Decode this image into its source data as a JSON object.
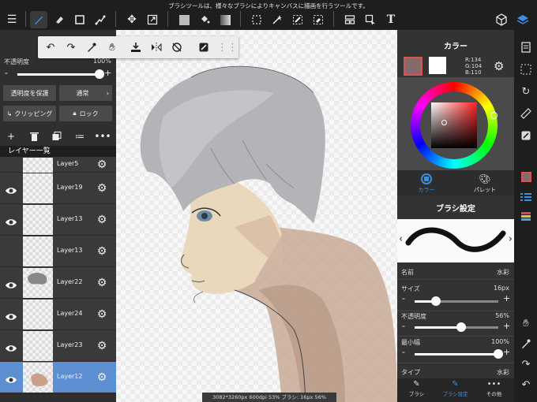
{
  "topbar": {
    "message": "ブラシツールは、様々なブラシによりキャンバスに描画を行うツールです。",
    "icons": [
      "menu-icon",
      "brush-icon",
      "eraser-icon",
      "rect-shape-icon",
      "transform-icon",
      "move-icon",
      "resize-icon",
      "fill-color-icon",
      "bucket-icon",
      "gradient-icon",
      "select-rect-icon",
      "magic-wand-icon",
      "select-pen-icon",
      "select-eraser-icon",
      "reference-icon",
      "select-layer-icon",
      "text-icon",
      "materials-icon",
      "layers-icon"
    ]
  },
  "floatbar": {
    "icons": [
      "undo-icon",
      "redo-icon",
      "eyedropper-icon",
      "hand-icon",
      "save-icon",
      "flip-icon",
      "rotate-reset-icon",
      "filter-icon",
      "grip-icon"
    ]
  },
  "left_panel": {
    "opacity_label": "不透明度",
    "opacity_value": "100%",
    "opacity_fraction": 1.0,
    "protect_alpha": "透明度を保護",
    "blend_mode": "通常",
    "clipping": "クリッピング",
    "lock": "ロック",
    "layer_list_title": "レイヤー一覧",
    "layers": [
      {
        "name": "Layer5",
        "visible": false,
        "active": false
      },
      {
        "name": "Layer19",
        "visible": true,
        "active": false
      },
      {
        "name": "Layer13",
        "visible": true,
        "active": false
      },
      {
        "name": "Layer13",
        "visible": false,
        "active": false
      },
      {
        "name": "Layer22",
        "visible": true,
        "active": false
      },
      {
        "name": "Layer24",
        "visible": true,
        "active": false
      },
      {
        "name": "Layer23",
        "visible": true,
        "active": false
      },
      {
        "name": "Layer12",
        "visible": true,
        "active": true
      }
    ]
  },
  "color_panel": {
    "title": "カラー",
    "r": "R:134",
    "g": "G:104",
    "b": "B:110",
    "fg_color": "#866a6e",
    "tab_color": "カラー",
    "tab_palette": "パレット"
  },
  "brush_panel": {
    "title": "ブラシ設定",
    "name_label": "名前",
    "name_value": "水彩",
    "size_label": "サイズ",
    "size_value": "16px",
    "size_fraction": 0.16,
    "opacity_label": "不透明度",
    "opacity_value": "56%",
    "opacity_fraction": 0.56,
    "min_width_label": "最小幅",
    "min_width_value": "100%",
    "min_width_fraction": 1.0,
    "type_label": "タイプ",
    "type_value": "水彩",
    "tab_brush": "ブラシ",
    "tab_brush_settings": "ブラシ設定",
    "tab_other": "その他"
  },
  "status": "3082*3260px 600dpi 53% ブラシ: 16px 56%",
  "colors": {
    "accent": "#5c8ed1",
    "panel": "#333333"
  }
}
